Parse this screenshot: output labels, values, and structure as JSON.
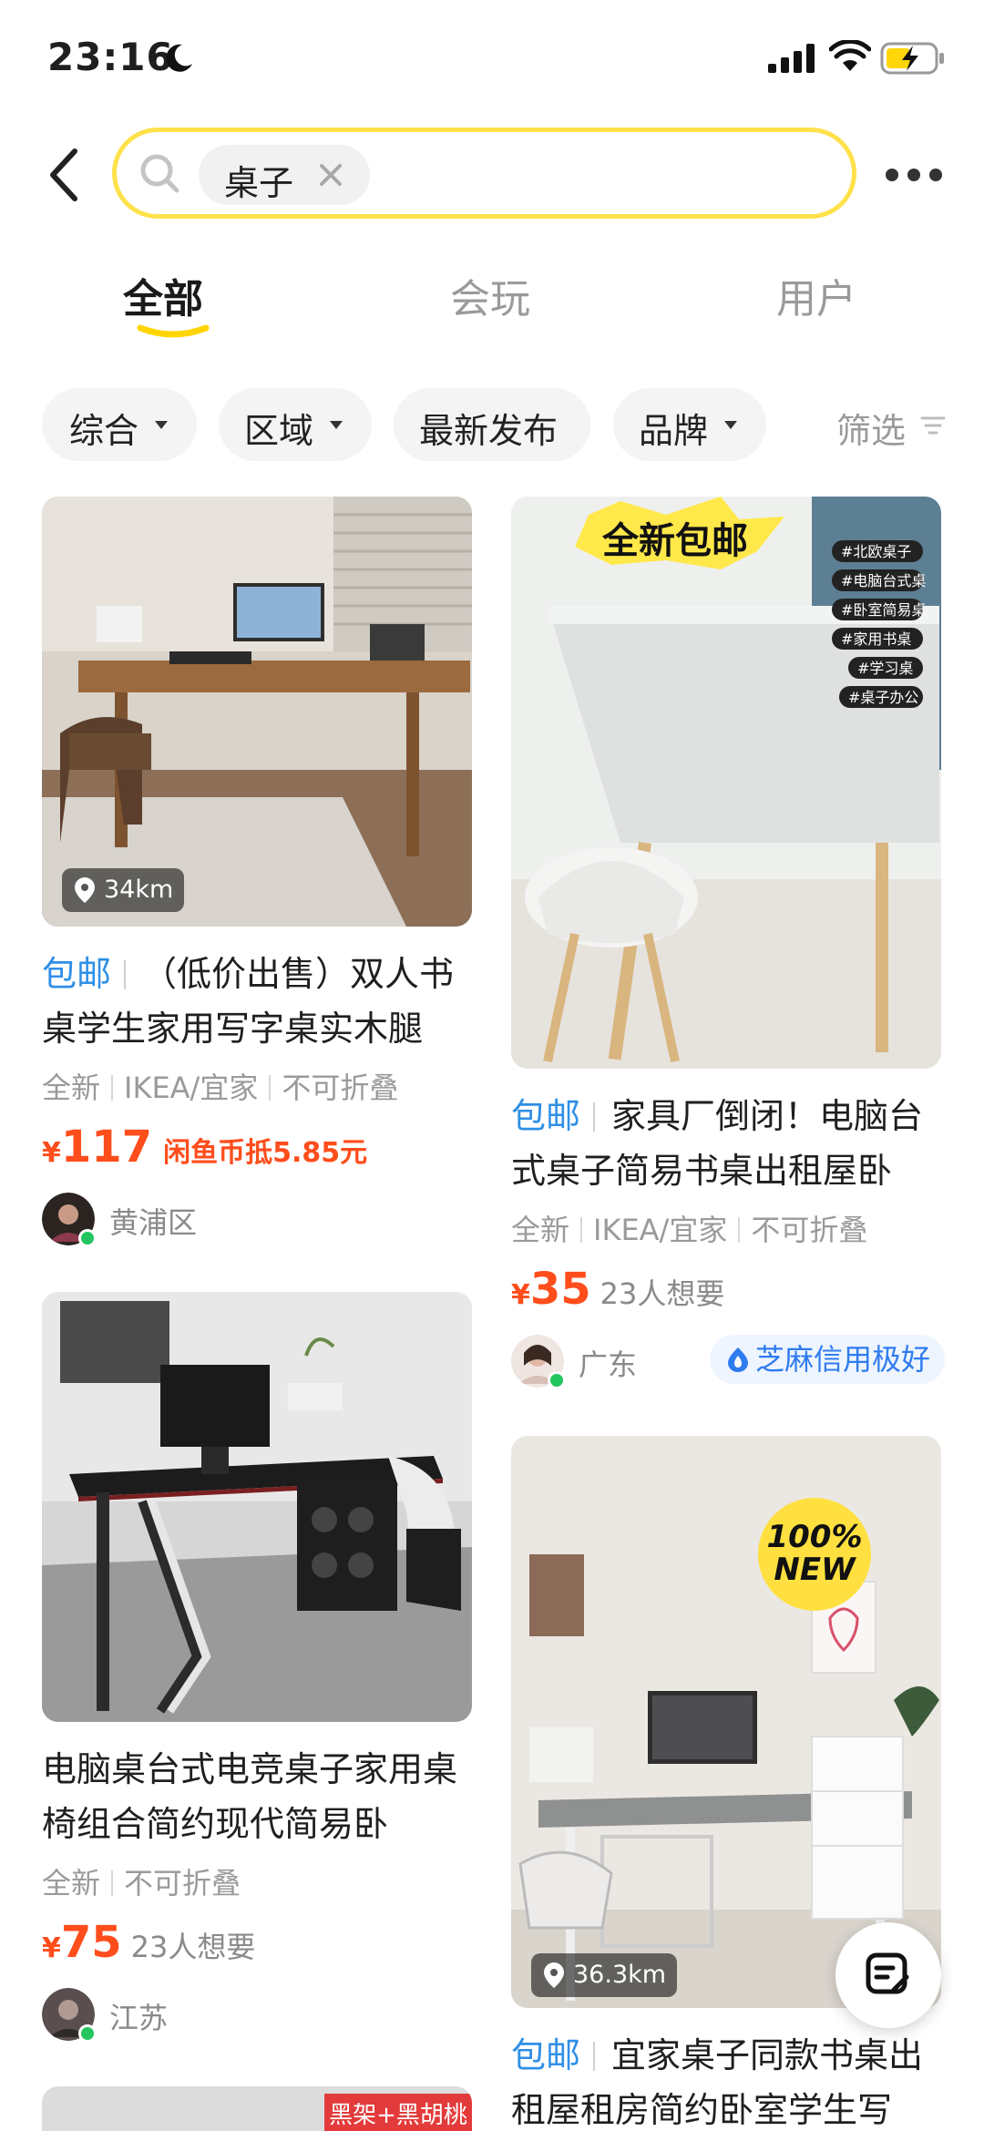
{
  "status_bar": {
    "time": "23:16"
  },
  "search": {
    "query": "桌子"
  },
  "tabs": [
    {
      "label": "全部",
      "active": true
    },
    {
      "label": "会玩",
      "active": false
    },
    {
      "label": "用户",
      "active": false
    }
  ],
  "filters": {
    "items": [
      "综合",
      "区域",
      "最新发布",
      "品牌"
    ],
    "screen_label": "筛选"
  },
  "colors": {
    "accent_yellow": "#ffe14a",
    "price_red": "#ff4d1c",
    "free_ship_blue": "#2f8fe6"
  },
  "cards": [
    {
      "distance": "34km",
      "free_shipping": "包邮",
      "title": "（低价出售）双人书桌学生家用写字桌实木腿",
      "tags": [
        "全新",
        "IKEA/宜家",
        "不可折叠"
      ],
      "price_currency": "¥",
      "price": "117",
      "price_extra": "闲鱼币抵5.85元",
      "location": "黄浦区"
    },
    {
      "image_text": "全新包邮",
      "image_tags": [
        "#北欧桌子",
        "#电脑台式桌",
        "#卧室简易桌",
        "#家用书桌",
        "#学习桌",
        "#桌子办公"
      ],
      "free_shipping": "包邮",
      "title": "家具厂倒闭！电脑台式桌子简易书桌出租屋卧",
      "tags": [
        "全新",
        "IKEA/宜家",
        "不可折叠"
      ],
      "price_currency": "¥",
      "price": "35",
      "wants": "23人想要",
      "location": "广东",
      "credit": "芝麻信用极好"
    },
    {
      "title": "电脑桌台式电竞桌子家用桌椅组合简约现代简易卧",
      "tags": [
        "全新",
        "不可折叠"
      ],
      "price_currency": "¥",
      "price": "75",
      "wants": "23人想要",
      "location": "江苏"
    },
    {
      "image_text": "100% NEW",
      "distance": "36.3km",
      "free_shipping": "包邮",
      "title": "宜家桌子同款书桌出租屋租房简约卧室学生写"
    },
    {
      "image_text": "黑架+黑胡桃"
    }
  ]
}
